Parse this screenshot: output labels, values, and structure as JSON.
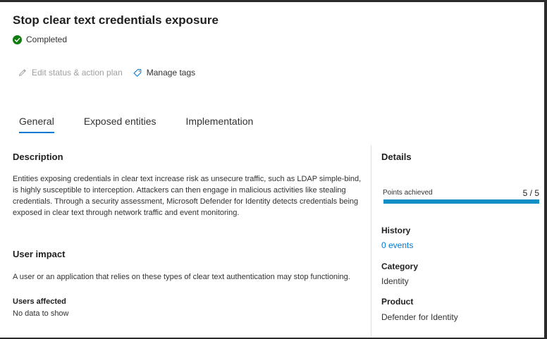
{
  "recommendation": {
    "title": "Stop clear text credentials exposure",
    "status": "Completed"
  },
  "actions": {
    "edit_label": "Edit status & action plan",
    "manage_tags_label": "Manage tags"
  },
  "tabs": [
    {
      "label": "General",
      "active": true
    },
    {
      "label": "Exposed entities",
      "active": false
    },
    {
      "label": "Implementation",
      "active": false
    }
  ],
  "general": {
    "description_title": "Description",
    "description_body": "Entities exposing credentials in clear text increase risk as unsecure traffic, such as LDAP simple-bind, is highly susceptible to interception. Attackers can then engage in malicious activities like stealing credentials. Through a security assessment, Microsoft Defender for Identity detects credentials being exposed in clear text through network traffic and event monitoring.",
    "user_impact_title": "User impact",
    "user_impact_body": "A user or an application that relies on these types of clear text authentication may stop functioning.",
    "users_affected_label": "Users affected",
    "users_affected_value": "No data to show"
  },
  "details": {
    "title": "Details",
    "points_label": "Points achieved",
    "points_value": "5 / 5",
    "points_fraction": 1.0,
    "history_label": "History",
    "history_value": "0 events",
    "category_label": "Category",
    "category_value": "Identity",
    "product_label": "Product",
    "product_value": "Defender for Identity"
  },
  "colors": {
    "accent": "#0078d4",
    "progress": "#0f8fc4",
    "success": "#107c10"
  }
}
